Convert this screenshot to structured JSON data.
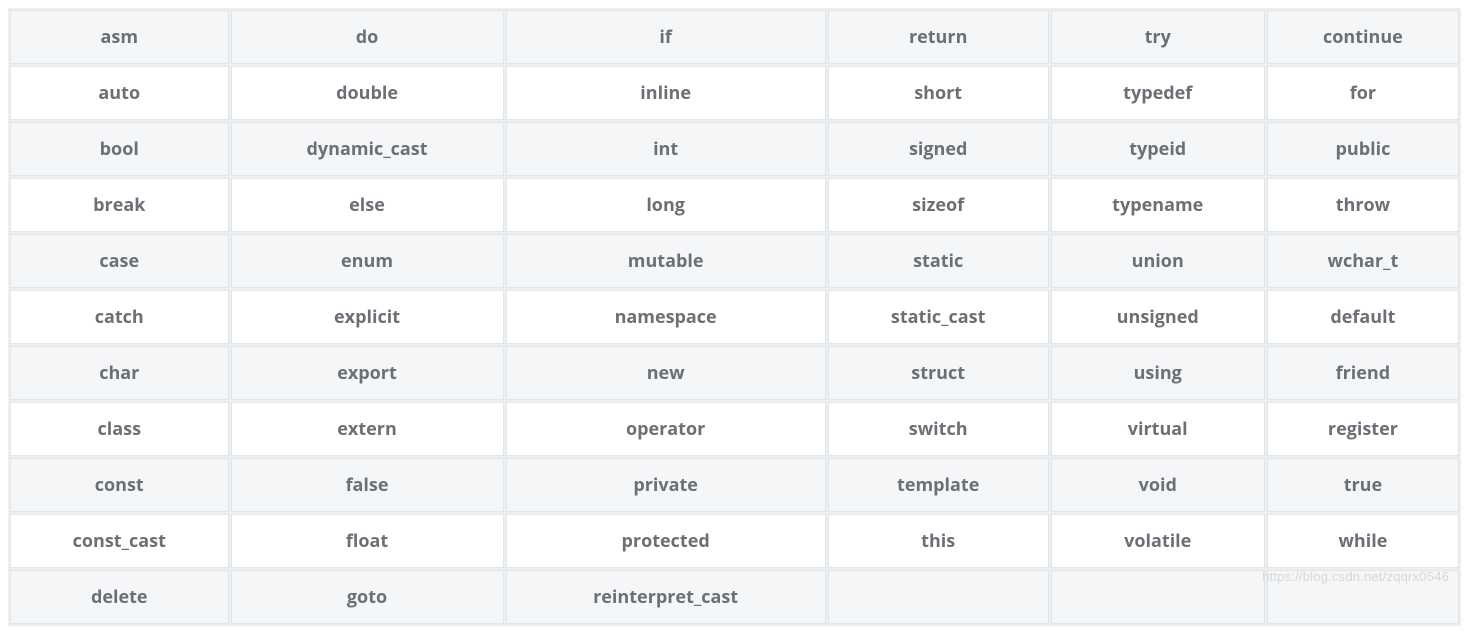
{
  "table": {
    "header": [
      "asm",
      "do",
      "if",
      "return",
      "try",
      "continue"
    ],
    "rows": [
      [
        "auto",
        "double",
        "inline",
        "short",
        "typedef",
        "for"
      ],
      [
        "bool",
        "dynamic_cast",
        "int",
        "signed",
        "typeid",
        "public"
      ],
      [
        "break",
        "else",
        "long",
        "sizeof",
        "typename",
        "throw"
      ],
      [
        "case",
        "enum",
        "mutable",
        "static",
        "union",
        "wchar_t"
      ],
      [
        "catch",
        "explicit",
        "namespace",
        "static_cast",
        "unsigned",
        "default"
      ],
      [
        "char",
        "export",
        "new",
        "struct",
        "using",
        "friend"
      ],
      [
        "class",
        "extern",
        "operator",
        "switch",
        "virtual",
        "register"
      ],
      [
        "const",
        "false",
        "private",
        "template",
        "void",
        "true"
      ],
      [
        "const_cast",
        "float",
        "protected",
        "this",
        "volatile",
        "while"
      ],
      [
        "delete",
        "goto",
        "reinterpret_cast",
        "",
        "",
        ""
      ]
    ]
  },
  "watermark": "https://blog.csdn.net/zqqrx0546"
}
